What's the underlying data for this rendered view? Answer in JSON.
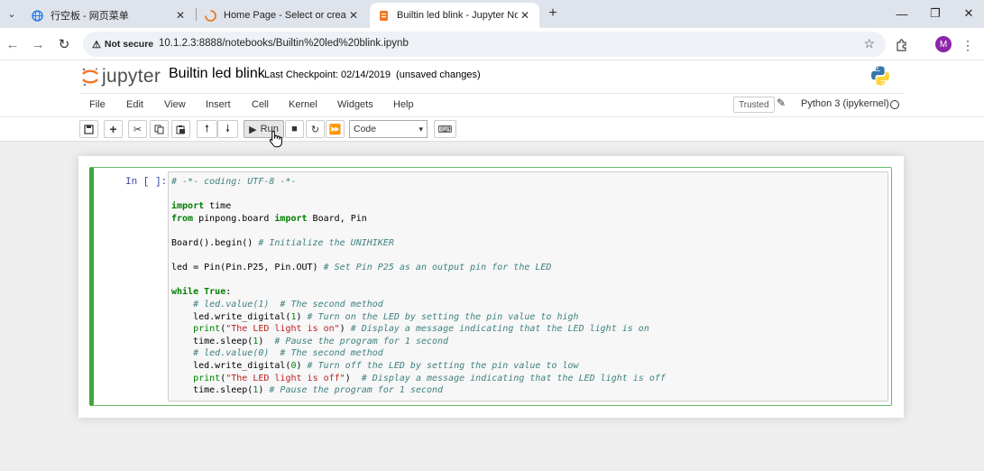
{
  "browser": {
    "tabs": [
      {
        "label": "行空板 - 网页菜单",
        "active": false
      },
      {
        "label": "Home Page - Select or create a",
        "active": false
      },
      {
        "label": "Builtin led blink - Jupyter Notel",
        "active": true
      }
    ],
    "security_label": "Not secure",
    "url": "10.1.2.3:8888/notebooks/Builtin%20led%20blink.ipynb",
    "avatar_letter": "M"
  },
  "jupyter": {
    "logo_text": "jupyter",
    "notebook_name": "Builtin led blink",
    "checkpoint": "Last Checkpoint: 02/14/2019",
    "unsaved": "(unsaved changes)",
    "menu": [
      "File",
      "Edit",
      "View",
      "Insert",
      "Cell",
      "Kernel",
      "Widgets",
      "Help"
    ],
    "trusted_label": "Trusted",
    "kernel_name": "Python 3 (ipykernel)",
    "run_label": "Run",
    "cell_type": "Code"
  },
  "cell": {
    "prompt": "In [ ]:"
  },
  "colors": {
    "cell_border": "#42a541",
    "prompt": "#303f9f",
    "comment": "#408080",
    "keyword": "#008000",
    "string": "#ba2121"
  }
}
